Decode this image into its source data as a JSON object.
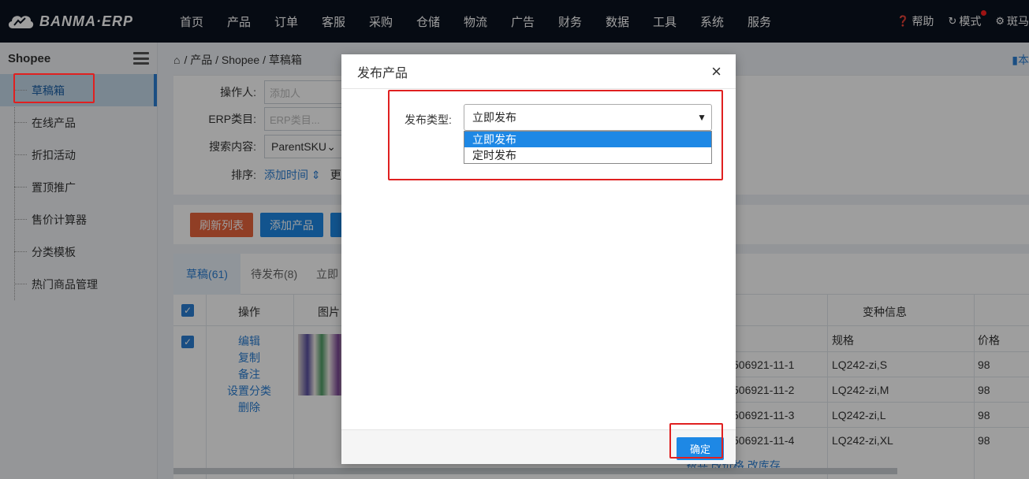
{
  "topnav": {
    "logo_text": "BANMA·ERP",
    "items": [
      "首页",
      "产品",
      "订单",
      "客服",
      "采购",
      "仓储",
      "物流",
      "广告",
      "财务",
      "数据",
      "工具",
      "系统",
      "服务"
    ],
    "help": "帮助",
    "mode": "模式",
    "user": "斑马"
  },
  "sidebar": {
    "title": "Shopee",
    "items": [
      "草稿箱",
      "在线产品",
      "折扣活动",
      "置顶推广",
      "售价计算器",
      "分类模板",
      "热门商品管理"
    ],
    "active_index": 0
  },
  "breadcrumb": {
    "parts": [
      "产品",
      "Shopee",
      "草稿箱"
    ],
    "separator": "/",
    "right_link": "本"
  },
  "filters": {
    "operator_label": "操作人:",
    "operator_placeholder": "添加人",
    "erp_category_label": "ERP类目:",
    "erp_category_placeholder": "ERP类目...",
    "search_label": "搜索内容:",
    "search_value": "ParentSKU",
    "sort_label": "排序:",
    "sort_value": "添加时间",
    "more": "更"
  },
  "buttons": {
    "refresh": "刷新列表",
    "add_product": "添加产品"
  },
  "tabs": [
    {
      "label": "草稿(61)"
    },
    {
      "label": "待发布(8)"
    },
    {
      "label": "立即"
    }
  ],
  "table": {
    "headers": {
      "operation": "操作",
      "image": "图片",
      "variant_info": "变种信息",
      "spec": "规格",
      "price": "价格"
    },
    "row_actions": [
      "编辑",
      "复制",
      "备注",
      "设置分类",
      "删除"
    ],
    "variants": [
      {
        "sku": "506921-11-1",
        "spec": "LQ242-zi,S",
        "price": "98"
      },
      {
        "sku": "506921-11-2",
        "spec": "LQ242-zi,M",
        "price": "98"
      },
      {
        "sku": "506921-11-3",
        "spec": "LQ242-zi,L",
        "price": "98"
      },
      {
        "sku": "506921-11-4",
        "spec": "LQ242-zi,XL",
        "price": "98"
      }
    ],
    "footer_links": "费共 改价格 改库存"
  },
  "modal": {
    "title": "发布产品",
    "close": "×",
    "field_label": "发布类型:",
    "select_value": "立即发布",
    "options": [
      "立即发布",
      "定时发布"
    ],
    "selected_option": 0,
    "confirm": "确定"
  },
  "colors": {
    "nav_bg": "#0b1220",
    "primary": "#1e88e5",
    "refresh_btn": "#e8643c",
    "highlight_box": "#e02020"
  }
}
